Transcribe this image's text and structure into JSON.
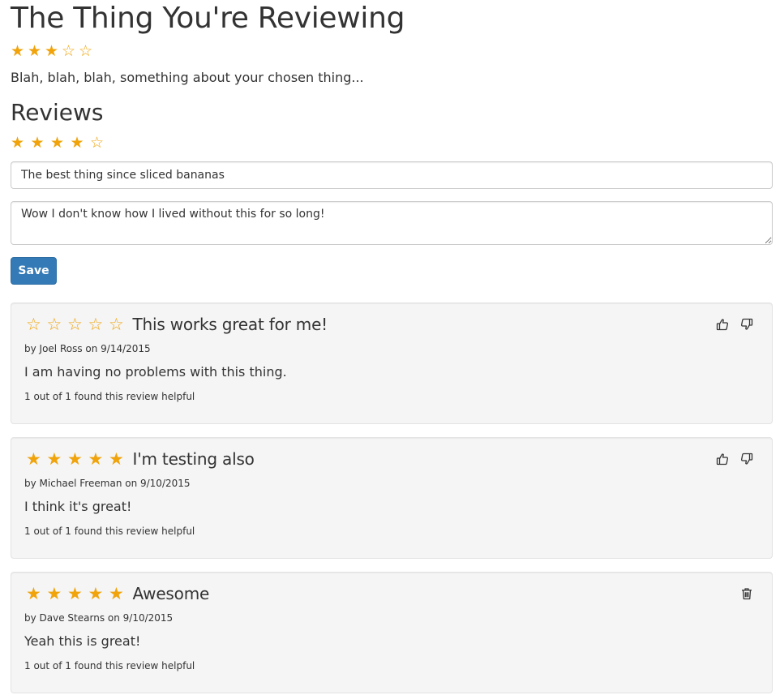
{
  "thing": {
    "title": "The Thing You're Reviewing",
    "rating": 3,
    "max_rating": 5,
    "description": "Blah, blah, blah, something about your chosen thing..."
  },
  "reviews_section": {
    "heading": "Reviews",
    "form": {
      "rating": 4,
      "max_rating": 5,
      "title_value": "The best thing since sliced bananas",
      "body_value": "Wow I don't know how I lived without this for so long!",
      "save_label": "Save"
    }
  },
  "reviews": [
    {
      "title": "This works great for me!",
      "rating": 0,
      "meta": "by Joel Ross on 9/14/2015",
      "text": "I am having no problems with this thing.",
      "helpful": "1 out of 1 found this review helpful",
      "actions": [
        "thumbs-up-icon",
        "thumbs-down-icon"
      ]
    },
    {
      "title": "I'm testing also",
      "rating": 5,
      "meta": "by Michael Freeman on 9/10/2015",
      "text": "I think it's great!",
      "helpful": "1 out of 1 found this review helpful",
      "actions": [
        "thumbs-up-icon",
        "thumbs-down-icon"
      ]
    },
    {
      "title": "Awesome",
      "rating": 5,
      "meta": "by Dave Stearns on 9/10/2015",
      "text": "Yeah this is great!",
      "helpful": "1 out of 1 found this review helpful",
      "actions": [
        "trash-icon"
      ]
    }
  ],
  "colors": {
    "star": "#f0a30a",
    "primary_button": "#337ab7",
    "card_background": "#f5f5f5",
    "text": "#333333"
  }
}
